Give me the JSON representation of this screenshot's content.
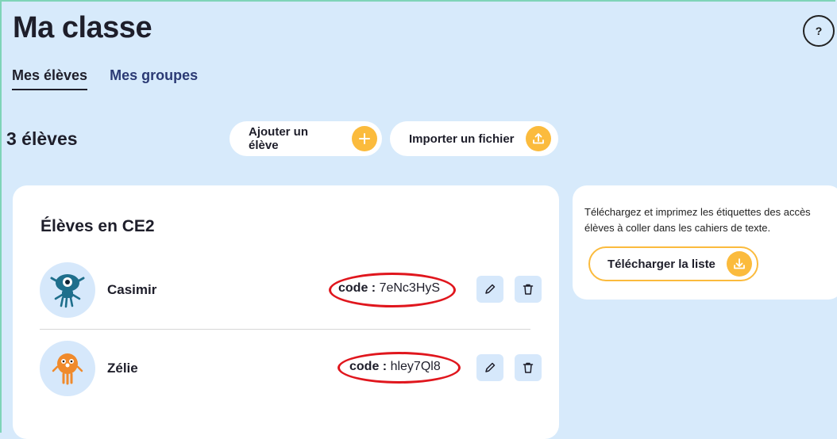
{
  "header": {
    "title": "Ma classe",
    "help_label": "?"
  },
  "tabs": [
    {
      "label": "Mes élèves",
      "active": true
    },
    {
      "label": "Mes groupes",
      "active": false
    }
  ],
  "toolbar": {
    "count": "3 élèves",
    "add_label": "Ajouter un élève",
    "import_label": "Importer un fichier"
  },
  "class_card": {
    "title": "Élèves en CE2",
    "students": [
      {
        "name": "Casimir",
        "code_label": "code :",
        "code": "7eNc3HyS"
      },
      {
        "name": "Zélie",
        "code_label": "code :",
        "code": "hley7Ql8"
      }
    ]
  },
  "side_card": {
    "text": "Téléchargez et imprimez les étiquettes des accès élèves à coller dans les cahiers de texte.",
    "download_label": "Télécharger la liste"
  },
  "colors": {
    "background": "#d7eafb",
    "accent": "#fbbb3d",
    "highlight": "#e0161d",
    "tab_inactive": "#2b3a74"
  }
}
